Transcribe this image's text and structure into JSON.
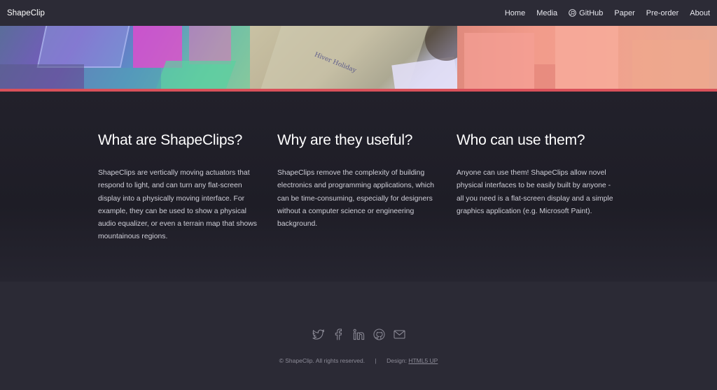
{
  "header": {
    "brand": "ShapeClip",
    "nav": [
      {
        "label": "Home"
      },
      {
        "label": "Media"
      },
      {
        "label": "GitHub",
        "icon": "github-icon"
      },
      {
        "label": "Paper"
      },
      {
        "label": "Pre-order"
      },
      {
        "label": "About"
      }
    ]
  },
  "banner": {
    "handwriting": "Hiver Holiday"
  },
  "sections": [
    {
      "title": "What are ShapeClips?",
      "body": "ShapeClips are vertically moving actuators that respond to light, and can turn any flat-screen display into a physically moving interface. For example, they can be used to show a physical audio equalizer, or even a terrain map that shows mountainous regions."
    },
    {
      "title": "Why are they useful?",
      "body": "ShapeClips remove the complexity of building electronics and programming applications, which can be time-consuming, especially for designers without a computer science or engineering background."
    },
    {
      "title": "Who can use them?",
      "body": "Anyone can use them! ShapeClips allow novel physical interfaces to be easily built by anyone - all you need is a flat-screen display and a simple graphics application (e.g. Microsoft Paint)."
    }
  ],
  "footer": {
    "social_icons": [
      "twitter-icon",
      "facebook-icon",
      "linkedin-icon",
      "github-icon",
      "email-icon"
    ],
    "copyright": "© ShapeClip. All rights reserved.",
    "separator": "|",
    "design_label": "Design:",
    "design_link": "HTML5 UP"
  },
  "colors": {
    "accent_line": "#d9515a",
    "header_bg": "#2c2b36",
    "main_bg": "#1f1e28",
    "footer_bg": "#2b2a35"
  }
}
